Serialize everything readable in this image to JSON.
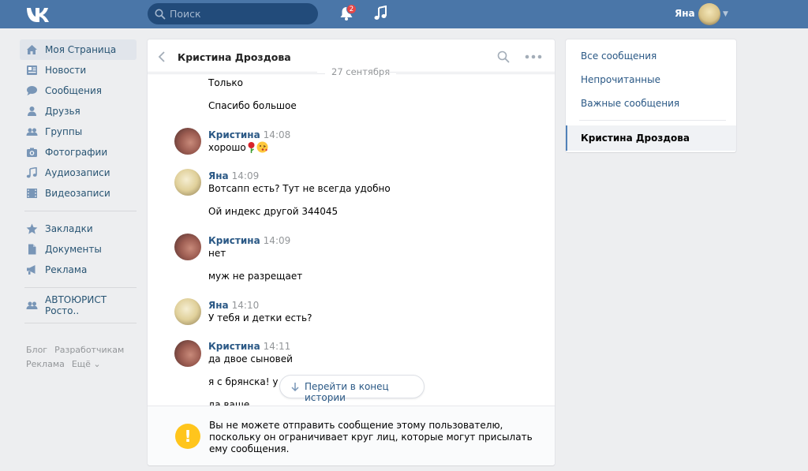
{
  "header": {
    "search_placeholder": "Поиск",
    "notifications_count": "2",
    "user_name": "Яна",
    "brand_color": "#4a76a8"
  },
  "nav": {
    "items": [
      {
        "label": "Моя Страница",
        "icon": "home-icon"
      },
      {
        "label": "Новости",
        "icon": "news-icon"
      },
      {
        "label": "Сообщения",
        "icon": "messages-icon"
      },
      {
        "label": "Друзья",
        "icon": "friends-icon"
      },
      {
        "label": "Группы",
        "icon": "groups-icon"
      },
      {
        "label": "Фотографии",
        "icon": "camera-icon"
      },
      {
        "label": "Аудиозаписи",
        "icon": "music-icon"
      },
      {
        "label": "Видеозаписи",
        "icon": "video-icon"
      },
      {
        "label": "Закладки",
        "icon": "star-icon"
      },
      {
        "label": "Документы",
        "icon": "document-icon"
      },
      {
        "label": "Реклама",
        "icon": "megaphone-icon"
      },
      {
        "label": "АВТОЮРИСТ Росто..",
        "icon": "group-icon"
      }
    ],
    "footer_links": [
      "Блог",
      "Разработчикам",
      "Реклама",
      "Ещё ⌄"
    ]
  },
  "chat": {
    "title": "Кристина Дроздова",
    "date_separator": "27 сентября",
    "messages": [
      {
        "text": "Только"
      },
      {
        "text": "Спасибо большое"
      },
      {
        "author": "Кристина",
        "time": "14:08",
        "text": "хорошо"
      },
      {
        "author": "Яна",
        "time": "14:09",
        "text": "Вотсапп есть? Тут не всегда удобно"
      },
      {
        "text": "Ой индекс другой 344045"
      },
      {
        "author": "Кристина",
        "time": "14:09",
        "text": "нет"
      },
      {
        "text": "муж не разрещает"
      },
      {
        "author": "Яна",
        "time": "14:10",
        "text": "У тебя и детки есть?"
      },
      {
        "author": "Кристина",
        "time": "14:11",
        "text": "да двое сыновей"
      },
      {
        "text": "я с брянска! у на"
      },
      {
        "text": "да ваше"
      }
    ],
    "goto_end_label": "Перейти в конец истории",
    "notice": "Вы не можете отправить сообщение этому пользователю, поскольку он ограничивает круг лиц, которые могут присылать ему сообщения."
  },
  "right_menu": {
    "items": [
      "Все сообщения",
      "Непрочитанные",
      "Важные сообщения"
    ],
    "active": "Кристина Дроздова"
  }
}
